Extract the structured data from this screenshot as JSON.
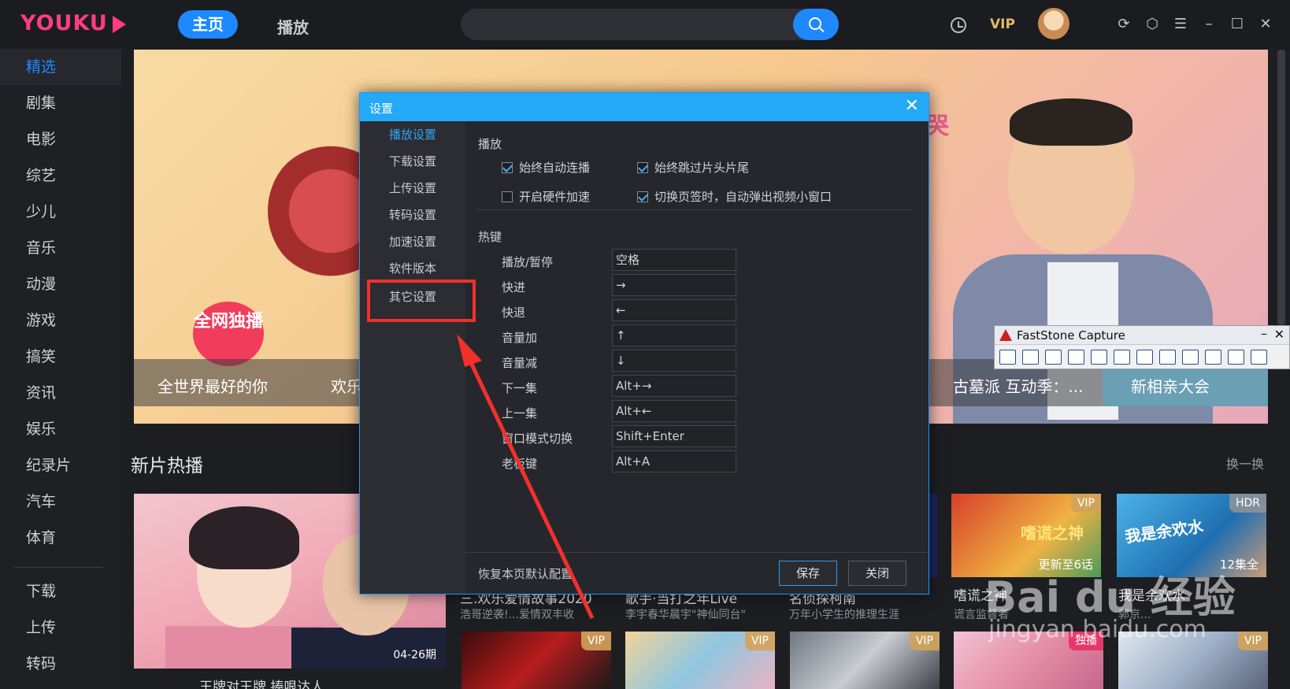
{
  "topbar": {
    "logo": "YOUKU",
    "nav_home": "主页",
    "nav_play": "播放",
    "vip": "VIP"
  },
  "sidebar": {
    "items": [
      "精选",
      "剧集",
      "电影",
      "综艺",
      "少儿",
      "音乐",
      "动漫",
      "游戏",
      "搞笑",
      "资讯",
      "娱乐",
      "纪录片",
      "汽车",
      "体育"
    ],
    "bottom": [
      "下载",
      "上传",
      "转码"
    ]
  },
  "banner": {
    "badge": "全网独播",
    "cry_label": "哭",
    "captions": [
      "全世界最好的你",
      "欢乐",
      "古墓派 互动季：...",
      "新相亲大会"
    ]
  },
  "section": {
    "title": "新片热播",
    "refresh": "换一换",
    "big_card": {
      "date": "04-26期",
      "title": "王牌对王牌 捧哏达人"
    },
    "cards": [
      {
        "title": "三.欢乐爱情故事2020",
        "sub": "浩哥逆袭!...爱情双丰收"
      },
      {
        "title": "歌手·当打之年Live",
        "sub": "李宇春华晨宇\"神仙同台\""
      },
      {
        "title": "名侦探柯南",
        "sub": "万年小学生的推理生涯"
      },
      {
        "title": "嗜谎之神",
        "sub": "谎言监督者",
        "tag": "VIP",
        "foot": "更新至6话",
        "poster_text": "嗜谎之神"
      },
      {
        "title": "我是余欢水",
        "sub": "郭京...",
        "tag": "HDR",
        "foot": "12集全",
        "poster_text": "我是余欢水"
      }
    ],
    "row2_tags": [
      "VIP",
      "VIP",
      "VIP",
      "独播",
      "VIP"
    ]
  },
  "dialog": {
    "title": "设置",
    "tabs": [
      "播放设置",
      "下载设置",
      "上传设置",
      "转码设置",
      "加速设置",
      "软件版本",
      "其它设置"
    ],
    "play_section": "播放",
    "options": [
      {
        "label": "始终自动连播",
        "checked": true
      },
      {
        "label": "始终跳过片头片尾",
        "checked": true
      },
      {
        "label": "开启硬件加速",
        "checked": false
      },
      {
        "label": "切换页签时，自动弹出视频小窗口",
        "checked": true
      }
    ],
    "hotkey_section": "热键",
    "hotkeys": [
      {
        "label": "播放/暂停",
        "value": "空格"
      },
      {
        "label": "快进",
        "value": "→"
      },
      {
        "label": "快退",
        "value": "←"
      },
      {
        "label": "音量加",
        "value": "↑"
      },
      {
        "label": "音量减",
        "value": "↓"
      },
      {
        "label": "下一集",
        "value": "Alt+→"
      },
      {
        "label": "上一集",
        "value": "Alt+←"
      },
      {
        "label": "窗口模式切换",
        "value": "Shift+Enter"
      },
      {
        "label": "老板键",
        "value": "Alt+A"
      }
    ],
    "restore_label": "恢复本页默认配置",
    "save_label": "保存",
    "close_label": "关闭"
  },
  "faststone": {
    "title": "FastStone Capture",
    "min": "–",
    "close": "✕"
  },
  "watermark": {
    "brand": "Bai du 经验",
    "url": "jingyan.baidu.com"
  },
  "colors": {
    "accent": "#1e88ff",
    "dialog_title": "#23a9f6",
    "highlight": "#f2302c",
    "vip_gold": "#e3b969"
  }
}
